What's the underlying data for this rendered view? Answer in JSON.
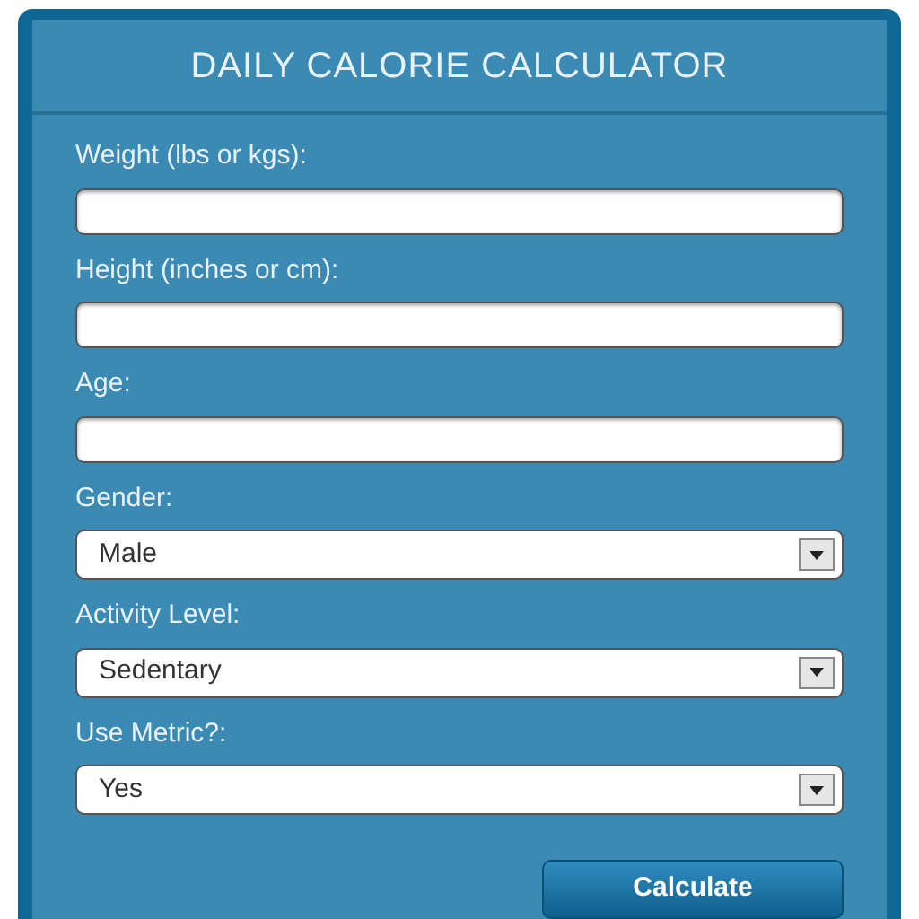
{
  "title": "DAILY CALORIE CALCULATOR",
  "fields": [
    {
      "kind": "text",
      "label": "Weight (lbs or kgs):"
    },
    {
      "kind": "text",
      "label": "Height (inches or cm):"
    },
    {
      "kind": "text",
      "label": "Age:"
    },
    {
      "kind": "select",
      "label": "Gender:",
      "value": "Male"
    },
    {
      "kind": "select",
      "label": "Activity Level:",
      "value": "Sedentary"
    },
    {
      "kind": "select",
      "label": "Use Metric?:",
      "value": "Yes"
    }
  ],
  "button": "Calculate"
}
